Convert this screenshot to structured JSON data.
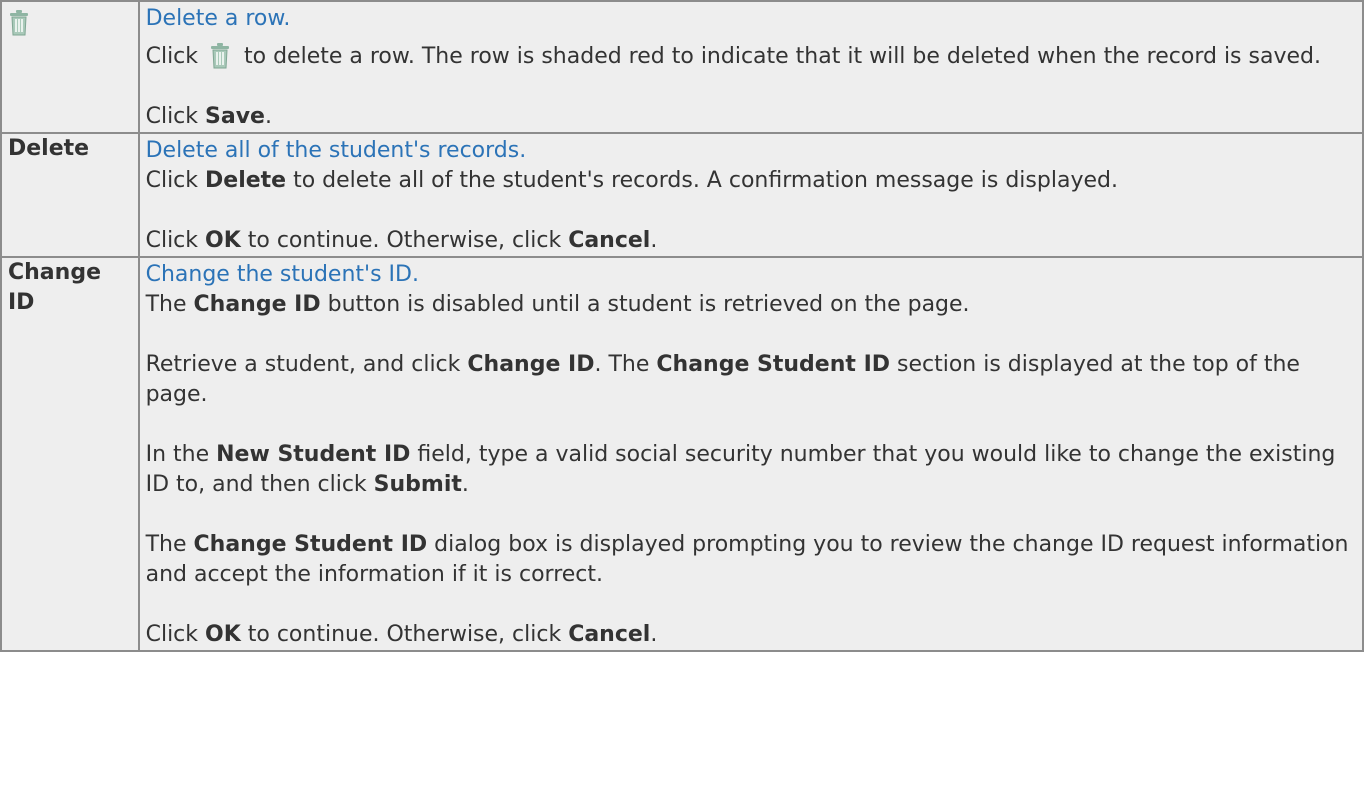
{
  "rows": [
    {
      "label": "",
      "icon": "trash-can-icon",
      "link": "Delete a row.",
      "p1_pre": "Click",
      "p1_post": "to delete a row. The row is shaded red to indicate that it will be deleted when the record is saved.",
      "p2_pre": "Click ",
      "p2_bold": "Save",
      "p2_post": "."
    },
    {
      "label": "Delete",
      "link": "Delete all of the student's records.",
      "p1_pre": "Click ",
      "p1_bold": "Delete",
      "p1_post": " to delete all of the student's records. A confirmation message is displayed.",
      "p2_pre": "Click ",
      "p2_bold1": "OK",
      "p2_mid": " to continue. Otherwise, click ",
      "p2_bold2": "Cancel",
      "p2_post": "."
    },
    {
      "label": "Change ID",
      "link": "Change the student's ID.",
      "p1_pre": "The ",
      "p1_bold": "Change ID",
      "p1_post": " button is disabled until a student is retrieved on the page.",
      "p2_pre": "Retrieve a student, and click ",
      "p2_bold1": "Change ID",
      "p2_mid": ". The ",
      "p2_bold2": "Change Student ID",
      "p2_post": " section is displayed at the top of the page.",
      "p3_pre": "In the ",
      "p3_bold1": "New Student ID",
      "p3_mid": " field, type a valid social security number that you would like to change the existing ID to, and then click ",
      "p3_bold2": "Submit",
      "p3_post": ".",
      "p4_pre": "The ",
      "p4_bold": "Change Student ID",
      "p4_post": " dialog box is displayed prompting you to review the change ID request information and accept the information if it is correct.",
      "p5_pre": "Click ",
      "p5_bold1": "OK",
      "p5_mid": " to continue. Otherwise, click ",
      "p5_bold2": "Cancel",
      "p5_post": "."
    }
  ],
  "colors": {
    "link": "#2b73b7",
    "cell_bg": "#eeeeee",
    "border": "#8c8c8c",
    "icon": "#8fb5a3"
  }
}
